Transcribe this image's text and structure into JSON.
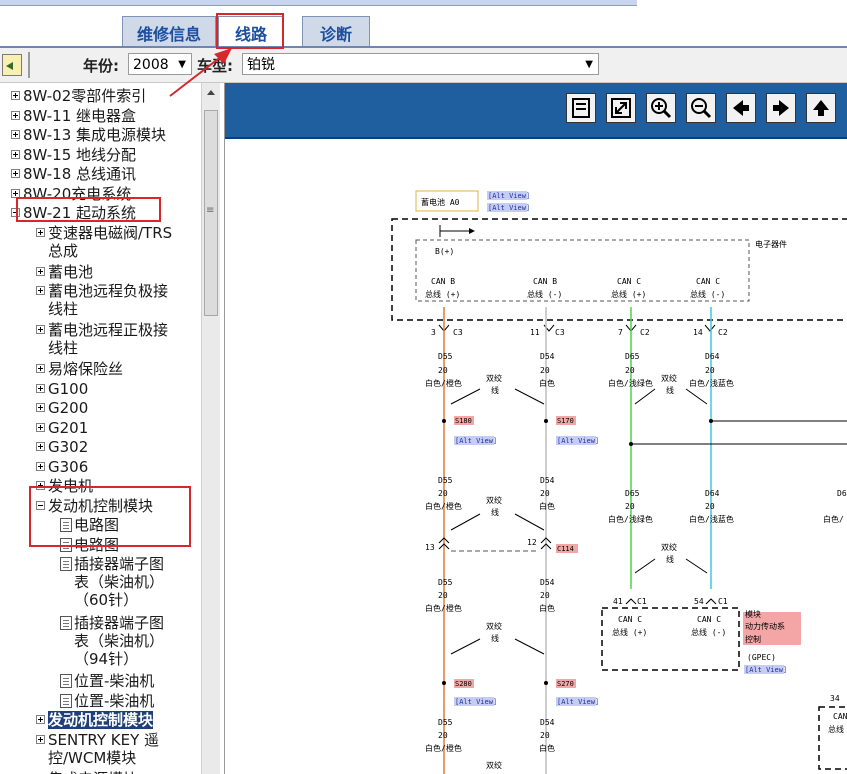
{
  "tabs": [
    {
      "label": "维修信息",
      "active": false
    },
    {
      "label": "线路",
      "active": true
    },
    {
      "label": "诊断",
      "active": false
    }
  ],
  "selectors": {
    "year_label": "年份:",
    "year_value": "2008",
    "model_label": "车型:",
    "model_value": "铂锐"
  },
  "tree": [
    {
      "text": "8W-02零部件索引",
      "indent": 0,
      "expander": "plus"
    },
    {
      "text": "8W-11 继电器盒",
      "indent": 0,
      "expander": "plus"
    },
    {
      "text": "8W-13 集成电源模块",
      "indent": 0,
      "expander": "plus"
    },
    {
      "text": "8W-15 地线分配",
      "indent": 0,
      "expander": "plus"
    },
    {
      "text": "8W-18 总线通讯",
      "indent": 0,
      "expander": "plus"
    },
    {
      "text": "8W-20充电系统",
      "indent": 0,
      "expander": "plus"
    },
    {
      "text": "8W-21 起动系统",
      "indent": 0,
      "expander": "minus"
    },
    {
      "text": "变速器电磁阀/TRS\n总成",
      "indent": 1,
      "expander": "plus"
    },
    {
      "text": "蓄电池",
      "indent": 1,
      "expander": "plus"
    },
    {
      "text": "蓄电池远程负极接\n线柱",
      "indent": 1,
      "expander": "plus"
    },
    {
      "text": "蓄电池远程正极接\n线柱",
      "indent": 1,
      "expander": "plus"
    },
    {
      "text": "易熔保险丝",
      "indent": 1,
      "expander": "plus"
    },
    {
      "text": "G100",
      "indent": 1,
      "expander": "plus"
    },
    {
      "text": "G200",
      "indent": 1,
      "expander": "plus"
    },
    {
      "text": "G201",
      "indent": 1,
      "expander": "plus"
    },
    {
      "text": "G302",
      "indent": 1,
      "expander": "plus"
    },
    {
      "text": "G306",
      "indent": 1,
      "expander": "plus"
    },
    {
      "text": "发电机",
      "indent": 1,
      "expander": "plus"
    },
    {
      "text": "发动机控制模块",
      "indent": 1,
      "expander": "minus"
    },
    {
      "text": "电路图",
      "indent": 2,
      "expander": "doc"
    },
    {
      "text": "电路图",
      "indent": 2,
      "expander": "doc"
    },
    {
      "text": "插接器端子图\n表（柴油机）\n（60针）",
      "indent": 2,
      "expander": "doc"
    },
    {
      "text": "插接器端子图\n表（柴油机）\n（94针）",
      "indent": 2,
      "expander": "doc"
    },
    {
      "text": "位置-柴油机",
      "indent": 2,
      "expander": "doc"
    },
    {
      "text": "位置-柴油机",
      "indent": 2,
      "expander": "doc"
    },
    {
      "text": "发动机控制模块",
      "indent": 1,
      "expander": "plus",
      "selected": true
    },
    {
      "text": "SENTRY KEY 遥\n控/WCM模块",
      "indent": 1,
      "expander": "plus"
    },
    {
      "text": "集成电源模块",
      "indent": 1,
      "expander": "plus"
    }
  ],
  "toolbar_icons": [
    "list-icon",
    "fit-icon",
    "zoom-in-icon",
    "zoom-out-icon",
    "left-arrow-icon",
    "right-arrow-icon",
    "up-arrow-icon"
  ],
  "diagram": {
    "battery": "蓄电池 A0",
    "alt_view": "[Alt View]",
    "module_label": "电子器件",
    "b_plus": "B(+)",
    "pins_top": [
      {
        "l1": "CAN B",
        "l2": "总线 (+)"
      },
      {
        "l1": "CAN B",
        "l2": "总线 (-)"
      },
      {
        "l1": "CAN C",
        "l2": "总线 (+)"
      },
      {
        "l1": "CAN C",
        "l2": "总线 (-)"
      }
    ],
    "connectors_top": [
      "3",
      "C3",
      "11",
      "C3",
      "7",
      "C2",
      "14",
      "C2"
    ],
    "wires": [
      {
        "code": "D55",
        "gauge": "20",
        "color": "白色/橙色"
      },
      {
        "code": "D54",
        "gauge": "20",
        "color": "白色"
      },
      {
        "code": "D65",
        "gauge": "20",
        "color": "白色/浅绿色"
      },
      {
        "code": "D64",
        "gauge": "20",
        "color": "白色/浅蓝色"
      }
    ],
    "twisted": "双绞",
    "twisted2": "线",
    "splices": [
      "S180",
      "S170",
      "S280",
      "S270"
    ],
    "c114": "C114",
    "pin13": "13",
    "pin12": "12",
    "pin41": "41",
    "pin54": "54",
    "c1": "C1",
    "pin34": "34",
    "pcm": {
      "l1": "模块",
      "l2": "动力传动系",
      "l3": "控制"
    },
    "gpec": "(GPEC)",
    "can_c": "CAN C",
    "bus_plus": "总线 (+)",
    "bus_minus": "总线 (-)",
    "can_part": "CAN",
    "bus_part": "总线",
    "d6": "D6",
    "color_part": "白色/",
    "colors": {
      "orange": "#e07a3a",
      "gray": "#bdbdbd",
      "green": "#4fd24f",
      "cyan": "#3ec9e0",
      "pink": "#f4a6a6",
      "altview": "#c6cdf5"
    }
  }
}
